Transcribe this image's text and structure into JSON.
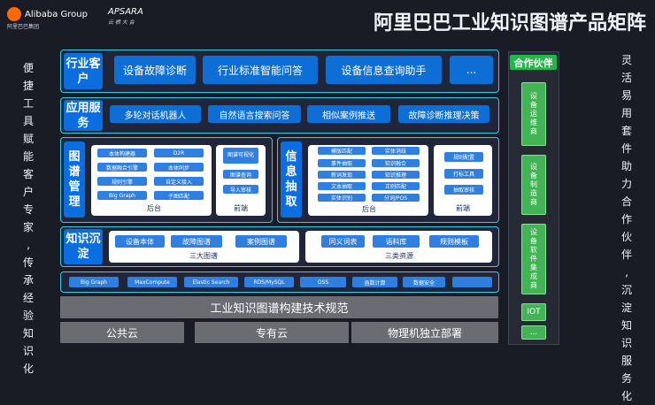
{
  "header": {
    "alibaba_logo": "Alibaba Group",
    "alibaba_sub": "阿里巴巴集团",
    "apsara_logo": "APSARA",
    "apsara_sub": "云 栖 大 会",
    "title": "阿里巴巴工业知识图谱产品矩阵"
  },
  "left_text": [
    "便",
    "捷",
    "工",
    "具",
    "赋",
    "能",
    "客",
    "户",
    "专",
    "家",
    ",",
    "传",
    "承",
    "经",
    "验",
    "知",
    "识",
    "化"
  ],
  "right_text": [
    "灵",
    "活",
    "易",
    "用",
    "套",
    "件",
    "助",
    "力",
    "合",
    "作",
    "伙",
    "伴",
    ",",
    "沉",
    "淀",
    "知",
    "识",
    "服",
    "务",
    "化"
  ],
  "industry": {
    "label": "行业客户",
    "items": [
      "设备故障诊断",
      "行业标准智能问答",
      "设备信息查询助手",
      "..."
    ]
  },
  "application": {
    "label": "应用服务",
    "items": [
      "多轮对话机器人",
      "自然语言搜索问答",
      "相似案例推送",
      "故障诊断推理决策"
    ]
  },
  "graph_mgmt": {
    "label": "图谱管理",
    "backend_items": [
      "本体构建器",
      "D2R",
      "数据融合引擎",
      "本体同步",
      "规则引擎",
      "自定义接入",
      "Big Graph",
      "子图匹配"
    ],
    "backend_label": "后台",
    "frontend_items": [
      "图谱可视化",
      "图谱查询",
      "导入审核"
    ],
    "frontend_label": "前端"
  },
  "info_extract": {
    "label": "信息抽取",
    "backend_items": [
      "模版匹配",
      "实体消歧",
      "事件抽取",
      "知识融合",
      "新词发现",
      "知识推理",
      "文本抽取",
      "正则匹配",
      "实体识别",
      "分词/POS"
    ],
    "backend_label": "后台",
    "frontend_items": [
      "规则配置",
      "打标工具",
      "抽取审核"
    ],
    "frontend_label": "前端"
  },
  "knowledge": {
    "label": "知识沉淀",
    "graph_items": [
      "设备本体",
      "故障图谱",
      "案例图谱"
    ],
    "graph_label": "三大图谱",
    "resource_items": [
      "同义词表",
      "语料库",
      "规则模板"
    ],
    "resource_label": "三类资源"
  },
  "infra": [
    "Big Graph",
    "MaxCompute",
    "Elastic Search",
    "RDS/MySQL",
    "OSS",
    "函数计算",
    "数据安全",
    ""
  ],
  "standard": "工业知识图谱构建技术规范",
  "deploy": [
    "公共云",
    "专有云",
    "物理机独立部署"
  ],
  "partners": {
    "title": "合作伙伴",
    "items": [
      "设备运维商",
      "设备制造商",
      "设备软件集成商",
      "IOT",
      "..."
    ]
  }
}
